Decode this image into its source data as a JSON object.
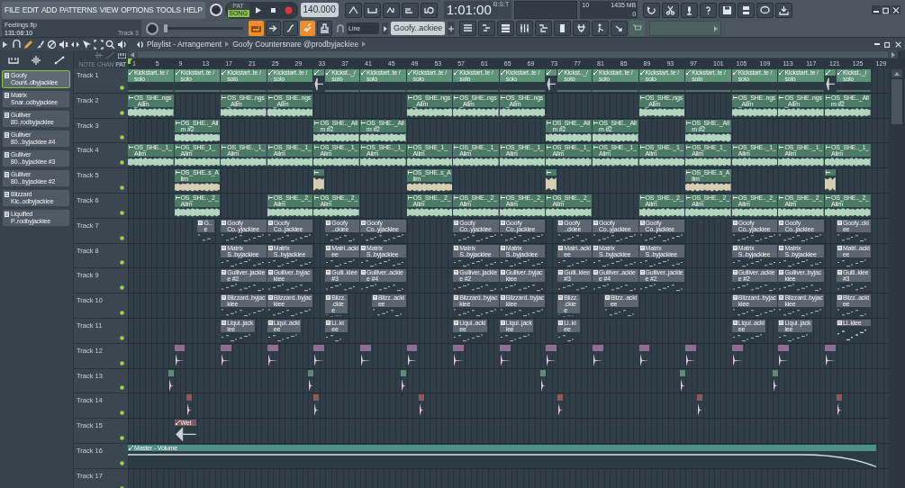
{
  "menu": [
    "FILE",
    "EDIT",
    "ADD",
    "PATTERNS",
    "VIEW",
    "OPTIONS",
    "TOOLS",
    "HELP"
  ],
  "transport": {
    "modes": [
      {
        "label": "PAT",
        "selected": false
      },
      {
        "label": "SONG",
        "selected": true
      }
    ],
    "tempo": "140.000",
    "time": "1:01:00",
    "time_format": "B:S:T"
  },
  "performance": {
    "cpu": "10",
    "memory": "1435 MB",
    "polyphony": "0"
  },
  "project": {
    "file": "Feelings.flp",
    "length": "131:08:10",
    "hint": "Track 3"
  },
  "snap": "Line",
  "pattern": "Goofy..ackiee",
  "playlist": {
    "title": "Playlist - Arrangement",
    "pattern": "Goofy Countersnare @prodbyjackiee",
    "header_labels": [
      "NOTE",
      "CHAN",
      "PAT"
    ],
    "ruler": [
      "1",
      "5",
      "9",
      "13",
      "17",
      "21",
      "25",
      "29",
      "33",
      "37",
      "41",
      "45",
      "49",
      "53",
      "57",
      "61",
      "65",
      "69",
      "73",
      "77",
      "81",
      "85",
      "89",
      "93",
      "97",
      "101",
      "105",
      "109",
      "113",
      "117",
      "121",
      "125",
      "129"
    ]
  },
  "channels": [
    {
      "label": "Goofy Count..dbyjackiee",
      "selected": true
    },
    {
      "label": "Matrix Snar..odbyjackiee",
      "selected": false
    },
    {
      "label": "Gulliver 80..rodbyjackiee",
      "selected": false
    },
    {
      "label": "Gulliver 80...byjackiee #4",
      "selected": false
    },
    {
      "label": "Gulliver 80...byjackiee #3",
      "selected": false
    },
    {
      "label": "Gulliver 80...byjackiee #2",
      "selected": false
    },
    {
      "label": "Blizzard Kic..odbyjackiee",
      "selected": false
    },
    {
      "label": "Liquified P..rodbyjackiee",
      "selected": false
    }
  ],
  "tracks": [
    {
      "name": "Track 1",
      "kind": "automation",
      "color": "#5e9378",
      "clips": [
        {
          "label": "Kickstart..te / solo"
        },
        {
          "label": "Kickstart..te / solo"
        },
        {
          "label": "Kickstart..te / solo"
        },
        {
          "label": "Kickstart..te / solo"
        },
        {
          "label": "Kickst.._/ solo"
        },
        {
          "label": "Kickstart..te / solo"
        },
        {
          "label": "Kickstart..te / solo"
        },
        {
          "label": "Kickstart..te / solo"
        },
        {
          "label": "Kickstart..te / solo"
        },
        {
          "label": "Kickst.._/ solo"
        },
        {
          "label": "Kickstart..te / solo"
        },
        {
          "label": "Kickstart..te / solo"
        },
        {
          "label": "Kickstart..te / solo"
        },
        {
          "label": "Kickstart..te / solo"
        },
        {
          "label": "Kickstart..te / solo"
        },
        {
          "label": "Kickst.._/ solo"
        }
      ]
    },
    {
      "name": "Track 2",
      "kind": "audio",
      "color": "#b4d4c0",
      "clips": [
        {
          "label": "OS_SHE..ngs_Allm"
        },
        {
          "label": "OS_SHE..ngs_Allm"
        },
        {
          "label": "OS_SHE..ngs_Allm"
        },
        {
          "label": "OS_SHE..ngs_Allm"
        },
        {
          "label": "OS_SHE..ngs_Allm"
        },
        {
          "label": "OS_SHE..ngs_Allm"
        },
        {
          "label": "OS_SHE..ngs_Allm"
        },
        {
          "label": "OS_SHE..ngs_Allm"
        },
        {
          "label": "OS_SHE..ngs_Allm"
        },
        {
          "label": "OS_SHE.._Allm #2"
        }
      ]
    },
    {
      "name": "Track 3",
      "kind": "audio",
      "color": "#b4d4c0",
      "clips": [
        {
          "label": "OS_SHE.._Allm #2"
        },
        {
          "label": "OS_SHE.._Allm #2"
        },
        {
          "label": "OS_SHE.._Allm #2"
        },
        {
          "label": "OS_SHE.._Allm #2"
        },
        {
          "label": "OS_SHE.._Allm #2"
        },
        {
          "label": "OS_SHE.._Allm #2"
        }
      ]
    },
    {
      "name": "Track 4",
      "kind": "audio",
      "color": "#b4d4c0",
      "clips": [
        {
          "label": "OS_SHE.._1_Allm"
        },
        {
          "label": "OS_SHE_1_Allm"
        },
        {
          "label": "OS_SHE.._1_Allm"
        },
        {
          "label": "OS_SHE.._1_Allm"
        },
        {
          "label": "OS_SHE.._1_Allm"
        },
        {
          "label": "OS_SHE.._1_Allm"
        },
        {
          "label": "OS_SHE_1_Allm"
        },
        {
          "label": "OS_SHE.._1_Allm"
        },
        {
          "label": "OS_SHE.._1_Allm"
        },
        {
          "label": "OS_SHE.._1_Allm"
        },
        {
          "label": "OS_SHE.._1_Allm"
        },
        {
          "label": "OS_SHE.._1_Allm"
        },
        {
          "label": "OS_SHE_1_Allm"
        },
        {
          "label": "OS_SHE.._1_Allm"
        },
        {
          "label": "OS_SHE.._1_Allm"
        },
        {
          "label": "OS_SHE.._1_Allm"
        }
      ]
    },
    {
      "name": "Track 5",
      "kind": "audio",
      "color": "#d6cdb2",
      "clips": [
        {
          "label": "OS_SHE..s_Allm"
        },
        {
          "label": "OS_SHE..s_Allm"
        },
        {
          "label": "OS_SHE..s_Allm"
        }
      ]
    },
    {
      "name": "Track 6",
      "kind": "audio",
      "color": "#b4d4c0",
      "clips": [
        {
          "label": "OS_SHE.._2_Allm"
        },
        {
          "label": "OS_SHE.._2_Allm"
        },
        {
          "label": "OS_SHE.._2_Allm"
        },
        {
          "label": "OS_SHE.._2_Allm"
        },
        {
          "label": "OS_SHE.._2_Allm"
        },
        {
          "label": "OS_SHE.._2_Allm"
        },
        {
          "label": "OS_SHE.._2_Allm"
        },
        {
          "label": "OS_SHE.._2_Allm"
        },
        {
          "label": "OS_SHE.._2_Allm"
        },
        {
          "label": "OS_SHE.._2_Allm"
        },
        {
          "label": "OS_SHE.._2_Allm"
        },
        {
          "label": "OS_SHE.._2_Allm"
        }
      ]
    },
    {
      "name": "Track 7",
      "kind": "pattern",
      "color": "#5c6670",
      "clips": [
        {
          "label": "G..e"
        },
        {
          "label": "Goofy Co..yjackiee"
        },
        {
          "label": "Goofy Co..jackiee"
        },
        {
          "label": "Goofy ..ckiee"
        },
        {
          "label": "Goofy Co..yjackiee"
        },
        {
          "label": "Goofy Co..yjackiee"
        },
        {
          "label": "Goofy Co..jackiee"
        },
        {
          "label": "Goofy ..ckiee"
        },
        {
          "label": "Goofy Co..yjackiee"
        },
        {
          "label": "Goofy Co..jackiee"
        },
        {
          "label": "Goofy Co..yjackiee"
        },
        {
          "label": "Goofy Co..jackiee"
        },
        {
          "label": "Goofy..ckiee"
        }
      ]
    },
    {
      "name": "Track 8",
      "kind": "pattern",
      "color": "#5c6670",
      "clips": [
        {
          "label": "Matrix S..byjackiee"
        },
        {
          "label": "Matrix S..byjackiee"
        },
        {
          "label": "Matri..ackiee"
        },
        {
          "label": "Matrix S..byjackiee"
        },
        {
          "label": "Matrix S..byjackiee"
        },
        {
          "label": "Matrix S..byjackiee"
        },
        {
          "label": "Matri..ackiee"
        },
        {
          "label": "Matrix S..byjackiee"
        },
        {
          "label": "Matrix S..byjackiee"
        },
        {
          "label": "Matrix S..byjackiee"
        },
        {
          "label": "Matrix S..byjackiee"
        },
        {
          "label": "Matri..ackiee"
        }
      ]
    },
    {
      "name": "Track 9",
      "kind": "pattern",
      "color": "#5c6670",
      "clips": [
        {
          "label": "Gulliver..jackiee #2"
        },
        {
          "label": "Gulliver..byjackiee"
        },
        {
          "label": "Gulli..kiee #3"
        },
        {
          "label": "Gulliver..ackiee #4"
        },
        {
          "label": "Gulliver..jackiee #2"
        },
        {
          "label": "Gulliver..byjackiee"
        },
        {
          "label": "Gulli..kiee #3"
        },
        {
          "label": "Gulliver..ackiee #4"
        },
        {
          "label": "Gulliver..jackiee #2"
        },
        {
          "label": "Gulliver..ackiee #2"
        },
        {
          "label": "Gulliver..byjackiee"
        },
        {
          "label": "Gulli..kiee #3"
        }
      ]
    },
    {
      "name": "Track 10",
      "kind": "pattern",
      "color": "#5c6670",
      "clips": [
        {
          "label": "Blizzard..byjackiee"
        },
        {
          "label": "Blizzard..byjackiee"
        },
        {
          "label": "Blizz..ckiee"
        },
        {
          "label": "Blizz..ackiee"
        },
        {
          "label": "Blizzard..byjackiee"
        },
        {
          "label": "Blizzard..byjackiee"
        },
        {
          "label": "Blizz..ckiee"
        },
        {
          "label": "Blizz..ackiee"
        },
        {
          "label": "Blizzard..byjackiee"
        },
        {
          "label": "Blizzard..byjackiee"
        },
        {
          "label": "Blizz..ackiee"
        }
      ]
    },
    {
      "name": "Track 11",
      "kind": "pattern",
      "color": "#5c6670",
      "clips": [
        {
          "label": "Liqui..jackiee"
        },
        {
          "label": "Liqui..ackiee"
        },
        {
          "label": "Li..kiee"
        },
        {
          "label": "Liqui..ackiee"
        },
        {
          "label": "Liqui..jackiee"
        },
        {
          "label": "Li..kiee"
        },
        {
          "label": "Liqui..ackiee"
        },
        {
          "label": "Liqui..jackiee"
        },
        {
          "label": "Li..kiee"
        }
      ]
    },
    {
      "name": "Track 12",
      "kind": "oneshot",
      "color": "#8e6e92"
    },
    {
      "name": "Track 13",
      "kind": "oneshot",
      "color": "#5f8a78"
    },
    {
      "name": "Track 14",
      "kind": "oneshot",
      "color": "#8e5a58"
    },
    {
      "name": "Track 15",
      "kind": "automation",
      "color": "#7a5a62",
      "clips": [
        {
          "label": "Wet"
        }
      ]
    },
    {
      "name": "Track 16",
      "kind": "automation",
      "color": "#4e8f86",
      "clips": [
        {
          "label": "Master - Volume"
        }
      ]
    },
    {
      "name": "Track 17"
    }
  ]
}
